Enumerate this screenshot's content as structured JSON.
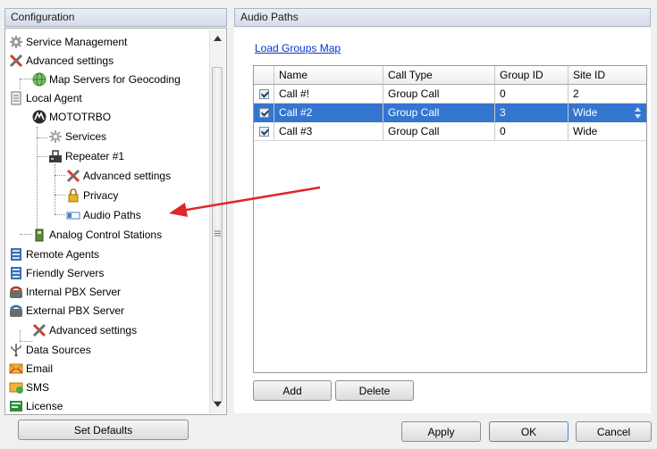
{
  "left": {
    "header": "Configuration",
    "tree": [
      {
        "id": "service-management",
        "label": "Service Management",
        "icon": "gear-icon"
      },
      {
        "id": "advanced-settings",
        "label": "Advanced settings",
        "icon": "tools-icon"
      },
      {
        "id": "map-servers",
        "label": "Map Servers for Geocoding",
        "icon": "globe-icon"
      },
      {
        "id": "local-agent",
        "label": "Local Agent",
        "icon": "document-icon"
      },
      {
        "id": "mototrbo",
        "label": "MOTOTRBO",
        "icon": "motorola-logo-icon"
      },
      {
        "id": "services",
        "label": "Services",
        "icon": "gear-icon"
      },
      {
        "id": "repeater-1",
        "label": "Repeater #1",
        "icon": "repeater-icon"
      },
      {
        "id": "repeater-advanced-settings",
        "label": "Advanced settings",
        "icon": "tools-icon"
      },
      {
        "id": "privacy",
        "label": "Privacy",
        "icon": "lock-icon"
      },
      {
        "id": "audio-paths",
        "label": "Audio Paths",
        "icon": "audio-paths-icon"
      },
      {
        "id": "analog-control-stations",
        "label": "Analog Control Stations",
        "icon": "radio-icon"
      },
      {
        "id": "remote-agents",
        "label": "Remote Agents",
        "icon": "server-icon"
      },
      {
        "id": "friendly-servers",
        "label": "Friendly Servers",
        "icon": "server-icon"
      },
      {
        "id": "internal-pbx",
        "label": "Internal PBX Server",
        "icon": "phone-icon"
      },
      {
        "id": "external-pbx",
        "label": "External PBX Server",
        "icon": "phone-icon"
      },
      {
        "id": "pbx-advanced-settings",
        "label": "Advanced settings",
        "icon": "tools-icon"
      },
      {
        "id": "data-sources",
        "label": "Data Sources",
        "icon": "usb-icon"
      },
      {
        "id": "email",
        "label": "Email",
        "icon": "email-icon"
      },
      {
        "id": "sms",
        "label": "SMS",
        "icon": "sms-icon"
      },
      {
        "id": "license",
        "label": "License",
        "icon": "license-icon"
      }
    ],
    "set_defaults_label": "Set Defaults"
  },
  "right": {
    "header": "Audio Paths",
    "load_link": "Load Groups Map",
    "columns": [
      "Name",
      "Call Type",
      "Group ID",
      "Site ID"
    ],
    "rows": [
      {
        "checked": true,
        "cells": [
          "Call #!",
          "Group Call",
          "0",
          "2"
        ]
      },
      {
        "checked": true,
        "cells": [
          "Call #2",
          "Group Call",
          "3",
          "Wide"
        ]
      },
      {
        "checked": true,
        "cells": [
          "Call #3",
          "Group Call",
          "0",
          "Wide"
        ]
      }
    ],
    "add_label": "Add",
    "delete_label": "Delete"
  },
  "footer": {
    "apply_label": "Apply",
    "ok_label": "OK",
    "cancel_label": "Cancel"
  },
  "colors": {
    "selection": "#3475cf",
    "link": "#0a33c8",
    "arrow": "#e3262a"
  }
}
